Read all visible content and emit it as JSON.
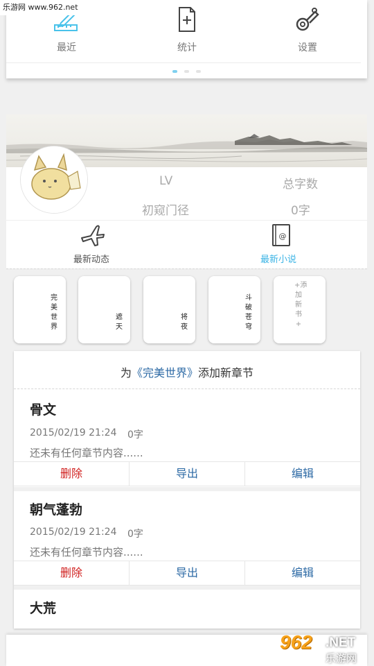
{
  "watermark_top": "乐游网 www.962.net",
  "watermark_bottom": {
    "logo": "962",
    "domain": ".NET",
    "name": "乐游网"
  },
  "top_menu": [
    {
      "label": "最近",
      "icon": "pencil-ruler-icon"
    },
    {
      "label": "统计",
      "icon": "add-document-icon"
    },
    {
      "label": "设置",
      "icon": "wrench-icon"
    }
  ],
  "page_dots": {
    "count": 3,
    "active": 0
  },
  "profile": {
    "lv_label": "LV",
    "total_words_label": "总字数",
    "level_name": "初窥门径",
    "total_words": "0字"
  },
  "tabs": {
    "activity": "最新动态",
    "novels": "最新小说",
    "active_color": "#3cb4e5"
  },
  "books": [
    {
      "title": "完美世界"
    },
    {
      "title": "遮天"
    },
    {
      "title": "将夜"
    },
    {
      "title": "斗破苍穹"
    }
  ],
  "add_book": "+添加新书+",
  "add_chapter": {
    "prefix": "为",
    "book": "《完美世界》",
    "suffix": "添加新章节"
  },
  "chapters": [
    {
      "name": "骨文",
      "date": "2015/02/19 21:24",
      "words": "0字",
      "desc": "还未有任何章节内容......"
    },
    {
      "name": "朝气蓬勃",
      "date": "2015/02/19 21:24",
      "words": "0字",
      "desc": "还未有任何章节内容......"
    },
    {
      "name": "大荒"
    }
  ],
  "actions": {
    "delete": "删除",
    "export": "导出",
    "edit": "编辑"
  },
  "colors": {
    "accent": "#3cb4e5",
    "delete": "#d0201f",
    "link": "#2d6aa5"
  }
}
